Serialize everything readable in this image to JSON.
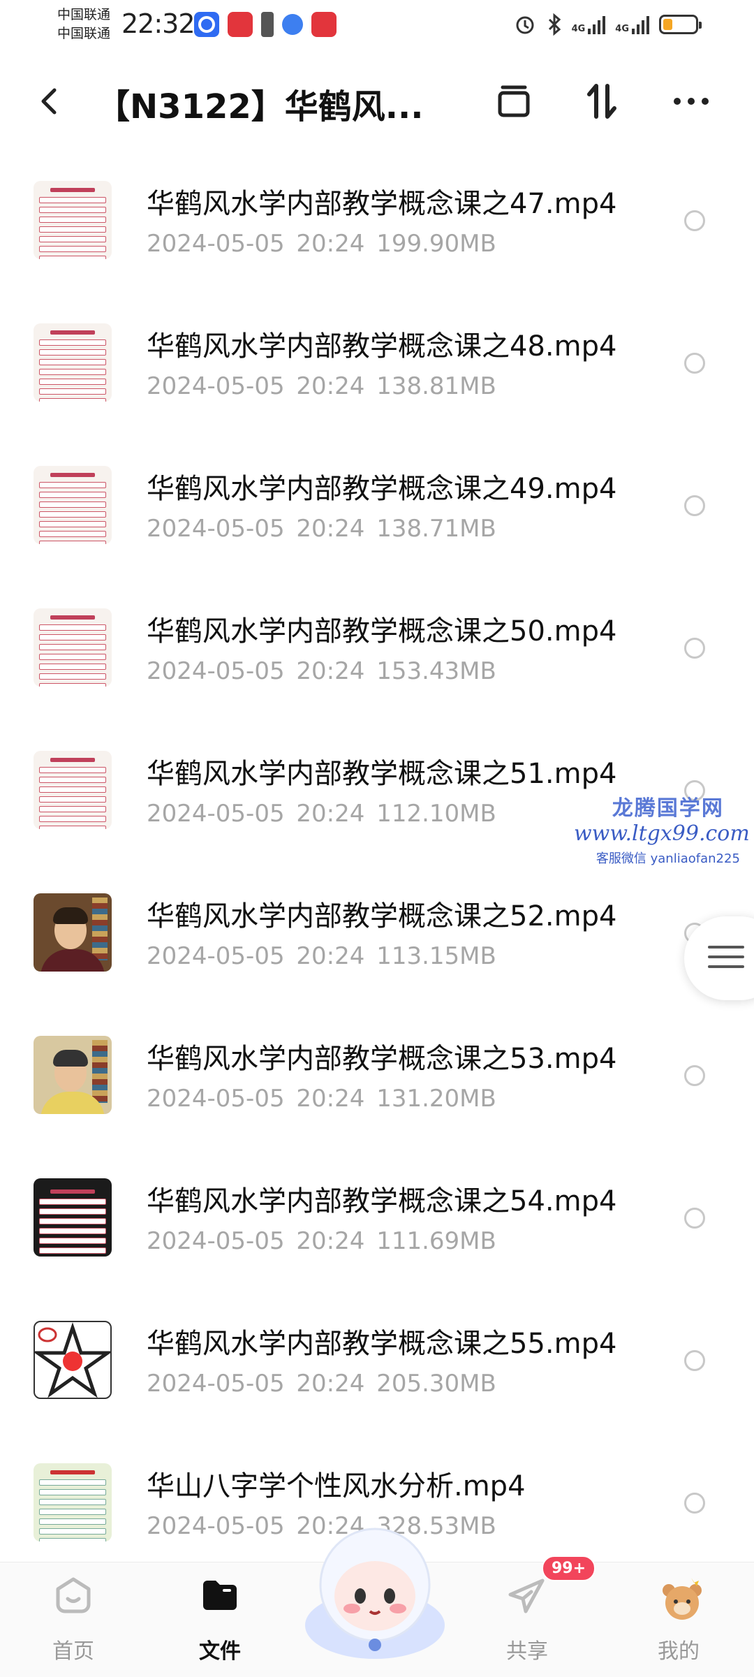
{
  "status_bar": {
    "carrier_1": "中国联通",
    "carrier_2": "中国联通",
    "time": "22:32",
    "network_1": "4G",
    "network_2": "4G",
    "battery_level": 0.3
  },
  "header": {
    "title": "【N3122】华鹤风...",
    "icons": [
      "back-icon",
      "archive-icon",
      "sort-icon",
      "more-icon"
    ]
  },
  "files": [
    {
      "name": "华鹤风水学内部教学概念课之47.mp4",
      "date": "2024-05-05",
      "time": "20:24",
      "size": "199.90MB",
      "thumb": "slide"
    },
    {
      "name": "华鹤风水学内部教学概念课之48.mp4",
      "date": "2024-05-05",
      "time": "20:24",
      "size": "138.81MB",
      "thumb": "slide"
    },
    {
      "name": "华鹤风水学内部教学概念课之49.mp4",
      "date": "2024-05-05",
      "time": "20:24",
      "size": "138.71MB",
      "thumb": "slide"
    },
    {
      "name": "华鹤风水学内部教学概念课之50.mp4",
      "date": "2024-05-05",
      "time": "20:24",
      "size": "153.43MB",
      "thumb": "slide"
    },
    {
      "name": "华鹤风水学内部教学概念课之51.mp4",
      "date": "2024-05-05",
      "time": "20:24",
      "size": "112.10MB",
      "thumb": "slide"
    },
    {
      "name": "华鹤风水学内部教学概念课之52.mp4",
      "date": "2024-05-05",
      "time": "20:24",
      "size": "113.15MB",
      "thumb": "person"
    },
    {
      "name": "华鹤风水学内部教学概念课之53.mp4",
      "date": "2024-05-05",
      "time": "20:24",
      "size": "131.20MB",
      "thumb": "person2"
    },
    {
      "name": "华鹤风水学内部教学概念课之54.mp4",
      "date": "2024-05-05",
      "time": "20:24",
      "size": "111.69MB",
      "thumb": "dark"
    },
    {
      "name": "华鹤风水学内部教学概念课之55.mp4",
      "date": "2024-05-05",
      "time": "20:24",
      "size": "205.30MB",
      "thumb": "star"
    },
    {
      "name": "华山八字学个性风水分析.mp4",
      "date": "2024-05-05",
      "time": "20:24",
      "size": "328.53MB",
      "thumb": "chart2"
    }
  ],
  "watermark": {
    "line1": "龙腾国学网",
    "line2": "www.ltgx99.com",
    "line3": "客服微信 yanliaofan225"
  },
  "bottom_nav": {
    "home": "首页",
    "files": "文件",
    "share": "共享",
    "share_badge": "99+",
    "mine": "我的"
  },
  "colors": {
    "active_tab": "#111111",
    "inactive_tab": "#999999",
    "meta_text": "#a6a6a6",
    "badge": "#f2455b"
  }
}
